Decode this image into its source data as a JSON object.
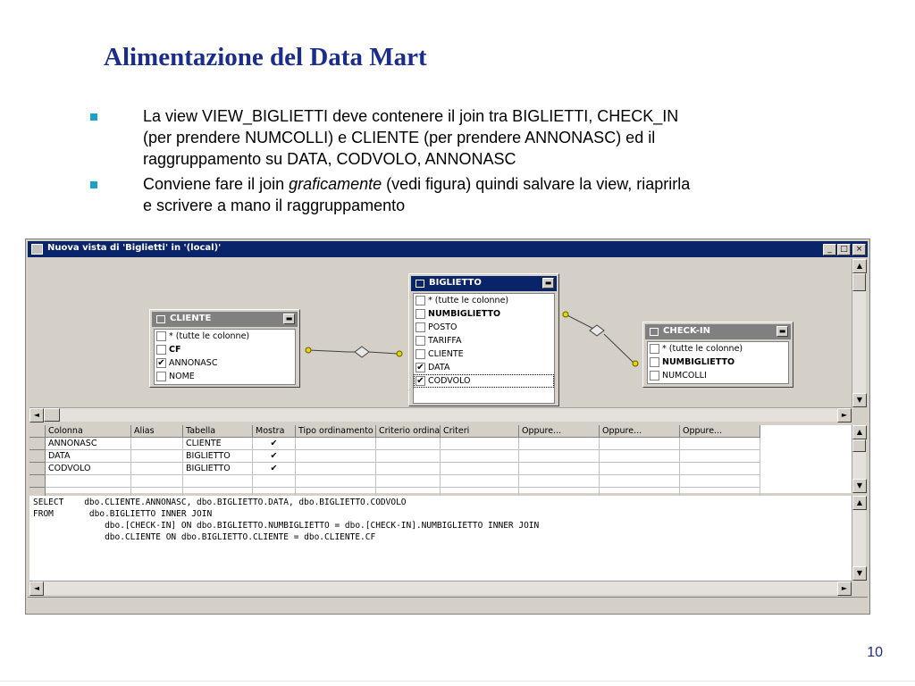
{
  "slide": {
    "title": "Alimentazione del Data Mart",
    "bullet1": {
      "line1": "La view VIEW_BIGLIETTI deve contenere il join tra BIGLIETTI, CHECK_IN",
      "line2": "(per prendere NUMCOLLI) e CLIENTE (per prendere ANNONASC) ed il",
      "line3": "raggruppamento su DATA, CODVOLO, ANNONASC"
    },
    "bullet2": {
      "line1_pre": "Conviene fare il join ",
      "line1_em": "graficamente",
      "line1_post": " (vedi figura) quindi salvare la view, riaprirla",
      "line2": "e scrivere a mano il raggruppamento"
    },
    "page_number": "10",
    "bullet_color": "#1aa3c8",
    "title_color": "#1a2d8c"
  },
  "window": {
    "title": "Nuova vista di 'Biglietti' in '(local)'",
    "controls": {
      "minimize": "_",
      "maximize": "□",
      "close": "×"
    }
  },
  "tables": {
    "cliente": {
      "name": "CLIENTE",
      "rows": [
        {
          "label": "* (tutte le colonne)",
          "checked": false,
          "bold": false
        },
        {
          "label": "CF",
          "checked": false,
          "bold": true
        },
        {
          "label": "ANNONASC",
          "checked": true,
          "bold": false
        },
        {
          "label": "NOME",
          "checked": false,
          "bold": false
        }
      ]
    },
    "biglietto": {
      "name": "BIGLIETTO",
      "rows": [
        {
          "label": "* (tutte le colonne)",
          "checked": false,
          "bold": false
        },
        {
          "label": "NUMBIGLIETTO",
          "checked": false,
          "bold": true
        },
        {
          "label": "POSTO",
          "checked": false,
          "bold": false
        },
        {
          "label": "TARIFFA",
          "checked": false,
          "bold": false
        },
        {
          "label": "CLIENTE",
          "checked": false,
          "bold": false
        },
        {
          "label": "DATA",
          "checked": true,
          "bold": false
        },
        {
          "label": "CODVOLO",
          "checked": true,
          "bold": false
        }
      ]
    },
    "checkin": {
      "name": "CHECK-IN",
      "rows": [
        {
          "label": "* (tutte le colonne)",
          "checked": false,
          "bold": false
        },
        {
          "label": "NUMBIGLIETTO",
          "checked": false,
          "bold": true
        },
        {
          "label": "NUMCOLLI",
          "checked": false,
          "bold": false
        }
      ]
    }
  },
  "grid": {
    "headers": [
      "Colonna",
      "Alias",
      "Tabella",
      "Mostra",
      "Tipo ordinamento",
      "Criterio ordina",
      "Criteri",
      "Oppure...",
      "Oppure...",
      "Oppure..."
    ],
    "rows": [
      [
        "ANNONASC",
        "",
        "CLIENTE",
        "✔",
        "",
        "",
        "",
        "",
        "",
        ""
      ],
      [
        "DATA",
        "",
        "BIGLIETTO",
        "✔",
        "",
        "",
        "",
        "",
        "",
        ""
      ],
      [
        "CODVOLO",
        "",
        "BIGLIETTO",
        "✔",
        "",
        "",
        "",
        "",
        "",
        ""
      ]
    ]
  },
  "sql": {
    "lines": [
      "SELECT    dbo.CLIENTE.ANNONASC, dbo.BIGLIETTO.DATA, dbo.BIGLIETTO.CODVOLO",
      "FROM       dbo.BIGLIETTO INNER JOIN",
      "              dbo.[CHECK-IN] ON dbo.BIGLIETTO.NUMBIGLIETTO = dbo.[CHECK-IN].NUMBIGLIETTO INNER JOIN",
      "              dbo.CLIENTE ON dbo.BIGLIETTO.CLIENTE = dbo.CLIENTE.CF"
    ]
  },
  "icons": {
    "scroll_up": "▲",
    "scroll_down": "▼",
    "scroll_left": "◄",
    "scroll_right": "►",
    "check": "✔"
  }
}
